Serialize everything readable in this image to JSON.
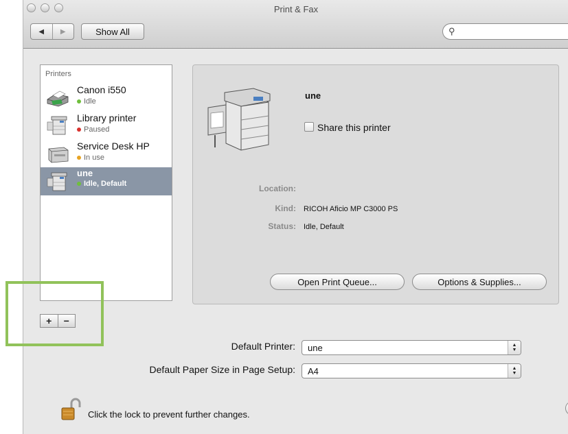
{
  "window": {
    "title": "Print & Fax"
  },
  "toolbar": {
    "back_icon": "◀",
    "forward_icon": "▶",
    "show_all_label": "Show All",
    "search_icon": "⚲"
  },
  "printers": {
    "heading": "Printers",
    "items": [
      {
        "name": "Canon i550",
        "status": "Idle",
        "status_color": "#6fbf3c",
        "selected": false
      },
      {
        "name": "Library printer",
        "status": "Paused",
        "status_color": "#d9322e",
        "selected": false
      },
      {
        "name": "Service Desk HP",
        "status": "In use",
        "status_color": "#e7a323",
        "selected": false
      },
      {
        "name": "une",
        "status": "Idle, Default",
        "status_color": "#6fbf3c",
        "selected": true
      }
    ],
    "add_label": "+",
    "remove_label": "−"
  },
  "detail": {
    "name": "une",
    "share_label": "Share this printer",
    "share_checked": false,
    "location_label": "Location:",
    "location_value": "",
    "kind_label": "Kind:",
    "kind_value": "RICOH Aficio MP C3000 PS",
    "status_label": "Status:",
    "status_value": "Idle, Default",
    "open_queue_label": "Open Print Queue...",
    "options_label": "Options & Supplies..."
  },
  "defaults": {
    "printer_label": "Default Printer:",
    "printer_value": "une",
    "paper_label": "Default Paper Size in Page Setup:",
    "paper_value": "A4"
  },
  "footer": {
    "lock_message": "Click the lock to prevent further changes.",
    "help_label": "?"
  },
  "colors": {
    "selection": "#8a96a6",
    "highlight_frame": "#91c25a"
  }
}
